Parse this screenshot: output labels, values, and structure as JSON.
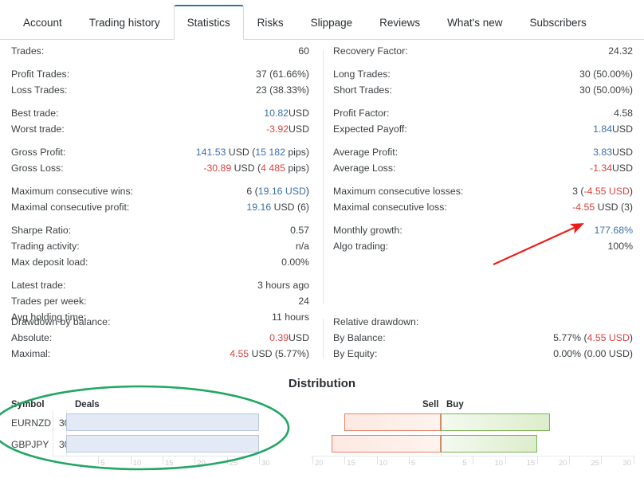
{
  "tabs": [
    {
      "label": "Account",
      "active": false
    },
    {
      "label": "Trading history",
      "active": false
    },
    {
      "label": "Statistics",
      "active": true
    },
    {
      "label": "Risks",
      "active": false
    },
    {
      "label": "Slippage",
      "active": false
    },
    {
      "label": "Reviews",
      "active": false
    },
    {
      "label": "What's new",
      "active": false
    },
    {
      "label": "Subscribers",
      "active": false
    }
  ],
  "stats_left": [
    {
      "key": "Trades:",
      "value": "60"
    },
    {
      "key": "Profit Trades:",
      "value": "37 (61.66%)"
    },
    {
      "key": "Loss Trades:",
      "value": "23 (38.33%)"
    },
    {
      "key": "Best trade:",
      "value": "10.82 USD"
    },
    {
      "key": "Worst trade:",
      "value": "-3.92 USD"
    },
    {
      "key": "Gross Profit:",
      "value": "141.53 USD (15 182 pips)"
    },
    {
      "key": "Gross Loss:",
      "value": "-30.89 USD (4 485 pips)"
    },
    {
      "key": "Maximum consecutive wins:",
      "value": "6 (19.16 USD)"
    },
    {
      "key": "Maximal consecutive profit:",
      "value": "19.16 USD (6)"
    },
    {
      "key": "Sharpe Ratio:",
      "value": "0.57"
    },
    {
      "key": "Trading activity:",
      "value": "n/a"
    },
    {
      "key": "Max deposit load:",
      "value": "0.00%"
    },
    {
      "key": "Latest trade:",
      "value": "3 hours ago"
    },
    {
      "key": "Trades per week:",
      "value": "24"
    },
    {
      "key": "Avg holding time:",
      "value": "11 hours"
    }
  ],
  "stats_right": [
    {
      "key": "Recovery Factor:",
      "value": "24.32"
    },
    {
      "key": "Long Trades:",
      "value": "30 (50.00%)"
    },
    {
      "key": "Short Trades:",
      "value": "30 (50.00%)"
    },
    {
      "key": "Profit Factor:",
      "value": "4.58"
    },
    {
      "key": "Expected Payoff:",
      "value": "1.84 USD"
    },
    {
      "key": "Average Profit:",
      "value": "3.83 USD"
    },
    {
      "key": "Average Loss:",
      "value": "-1.34 USD"
    },
    {
      "key": "Maximum consecutive losses:",
      "value": "3 (-4.55 USD)"
    },
    {
      "key": "Maximal consecutive loss:",
      "value": "-4.55 USD (3)"
    },
    {
      "key": "Monthly growth:",
      "value": "177.68%"
    },
    {
      "key": "Algo trading:",
      "value": "100%"
    }
  ],
  "drawdown_left": {
    "title": "Drawdown by balance:",
    "rows": [
      {
        "key": "Absolute:",
        "value": "0.39 USD"
      },
      {
        "key": "Maximal:",
        "value": "4.55 USD (5.77%)"
      }
    ]
  },
  "drawdown_right": {
    "title": "Relative drawdown:",
    "rows": [
      {
        "key": "By Balance:",
        "value": "5.77% (4.55 USD)"
      },
      {
        "key": "By Equity:",
        "value": "0.00% (0.00 USD)"
      }
    ]
  },
  "distribution": {
    "title": "Distribution",
    "col_symbol": "Symbol",
    "col_deals": "Deals",
    "lbl_sell": "Sell",
    "lbl_buy": "Buy"
  },
  "colors": {
    "accent_blue": "#3b6ea8",
    "negative_red": "#d9443f",
    "annotation_red": "#ee1c18",
    "annotation_green": "#21a663",
    "bar_deals_fill": "#e3eaf5",
    "bar_sell_border": "#e8836a",
    "bar_buy_border": "#7cb253"
  },
  "chart_data": [
    {
      "type": "bar",
      "title": "Deals",
      "orientation": "horizontal",
      "categories": [
        "EURNZD",
        "GBPJPY"
      ],
      "values": [
        30,
        30
      ],
      "labels": [
        "30",
        "30"
      ],
      "xlabel": "",
      "ylabel": "Symbol",
      "xlim": [
        0,
        30
      ],
      "ticks": [
        "5",
        "10",
        "15",
        "20",
        "25",
        "30"
      ],
      "grid": true,
      "legend": "none"
    },
    {
      "type": "bar",
      "title": "Sell / Buy",
      "orientation": "horizontal",
      "stacked": "diverging",
      "categories": [
        "EURNZD",
        "GBPJPY"
      ],
      "series": [
        {
          "name": "Sell",
          "values": [
            15,
            17
          ]
        },
        {
          "name": "Buy",
          "values": [
            17,
            15
          ]
        }
      ],
      "xlabel": "",
      "ylabel": "",
      "xlim": [
        -20,
        30
      ],
      "ticks_left": [
        "20",
        "15",
        "10",
        "5"
      ],
      "ticks_right": [
        "5",
        "10",
        "15",
        "20",
        "25",
        "30"
      ],
      "grid": true,
      "legend": "top"
    }
  ],
  "annotations": {
    "arrow": {
      "name": "red-arrow",
      "points_to": "Monthly growth: 177.68%",
      "color": "#ee1c18"
    },
    "ellipse": {
      "name": "green-ellipse",
      "encircles": "Deals distribution table",
      "color": "#21a663"
    }
  }
}
